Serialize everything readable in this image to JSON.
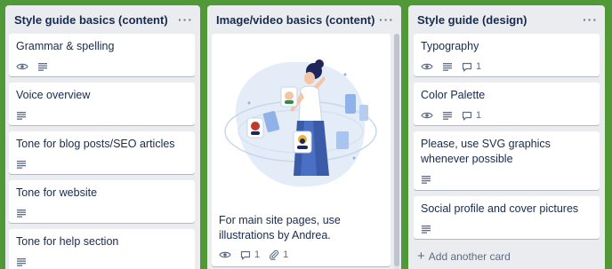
{
  "colors": {
    "board_background": "#519839",
    "list_background": "#ebecf0",
    "card_background": "#ffffff",
    "title_text": "#172b4d",
    "badge_text": "#5e6c84"
  },
  "lists": [
    {
      "title": "Style guide basics (content)",
      "menu_label": "···",
      "cards": [
        {
          "title": "Grammar & spelling",
          "badges": [
            "eye-icon",
            "description-icon"
          ]
        },
        {
          "title": "Voice overview",
          "badges": [
            "description-icon"
          ]
        },
        {
          "title": "Tone for blog posts/SEO articles",
          "badges": [
            "description-icon"
          ]
        },
        {
          "title": "Tone for website",
          "badges": [
            "description-icon"
          ]
        },
        {
          "title": "Tone for help section",
          "badges": [
            "description-icon"
          ]
        }
      ]
    },
    {
      "title": "Image/video basics (content)",
      "menu_label": "···",
      "cards": [
        {
          "title": "For main site pages, use illustrations by Andrea.",
          "cover": "illustration of woman with floating profile cards",
          "badges": [
            "eye-icon",
            "comment-icon",
            "attachment-icon"
          ],
          "comment_count": "1",
          "attachment_count": "1"
        }
      ]
    },
    {
      "title": "Style guide (design)",
      "menu_label": "···",
      "cards": [
        {
          "title": "Typography",
          "badges": [
            "eye-icon",
            "description-icon",
            "comment-icon"
          ],
          "comment_count": "1"
        },
        {
          "title": "Color Palette",
          "badges": [
            "eye-icon",
            "description-icon",
            "comment-icon"
          ],
          "comment_count": "1"
        },
        {
          "title": "Please, use SVG graphics whenever possible",
          "badges": [
            "description-icon"
          ]
        },
        {
          "title": "Social profile and cover pictures",
          "badges": [
            "description-icon"
          ]
        }
      ],
      "add_card_label": "Add another card",
      "add_card_icon": "plus-icon"
    }
  ]
}
